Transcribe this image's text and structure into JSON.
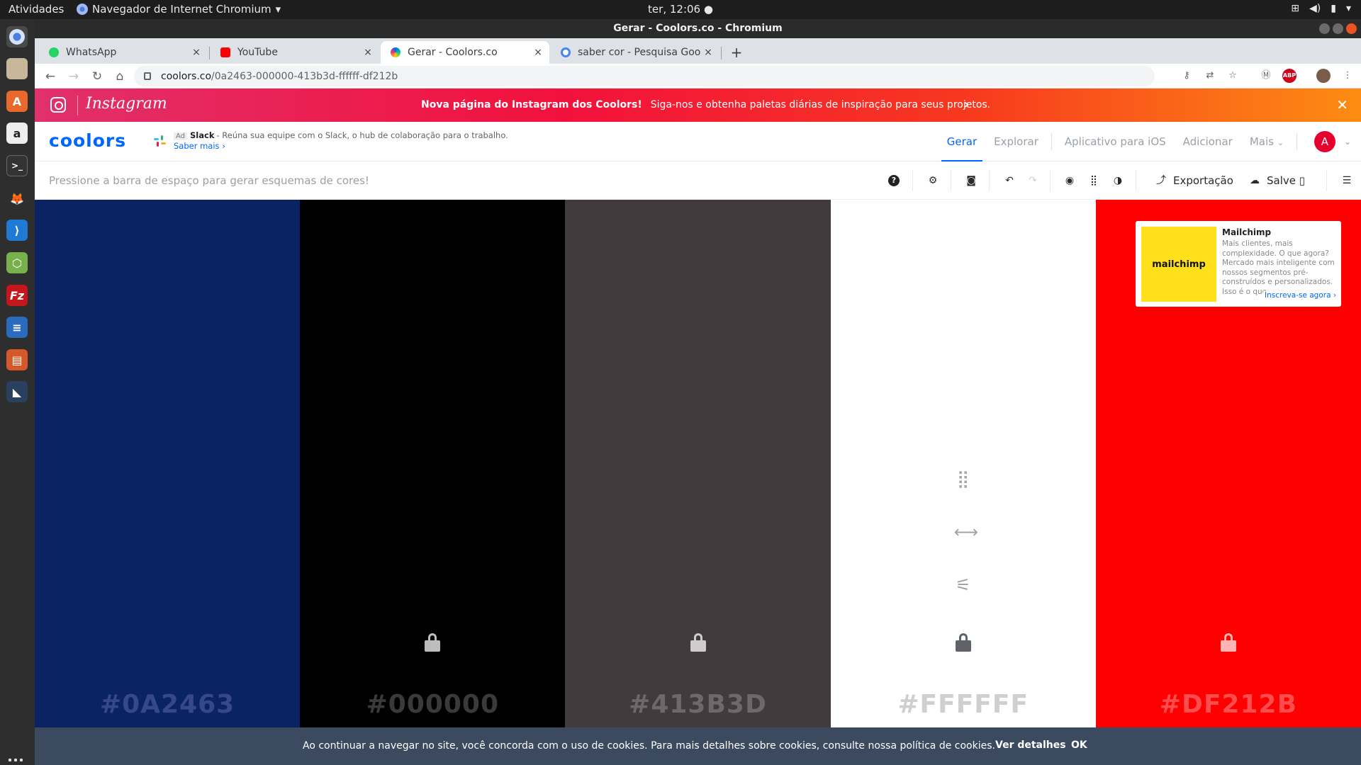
{
  "system": {
    "activities": "Atividades",
    "app_menu": "Navegador de Internet Chromium",
    "clock": "ter, 12:06 ●"
  },
  "window": {
    "title": "Gerar - Coolors.co - Chromium"
  },
  "tabs": [
    {
      "label": "WhatsApp",
      "favicon_color": "#25d366",
      "close": "×"
    },
    {
      "label": "YouTube",
      "favicon_color": "#ff0000",
      "close": "×"
    },
    {
      "label": "Gerar - Coolors.co",
      "favicon_color": "#0066ff",
      "close": "×",
      "active": true
    },
    {
      "label": "saber cor - Pesquisa Goog",
      "favicon_color": "#4285f4",
      "close": "×"
    }
  ],
  "address": {
    "host": "coolors.co",
    "path": "/0a2463-000000-413b3d-ffffff-df212b"
  },
  "ig_banner": {
    "brand": "Instagram",
    "headline": "Nova página do Instagram dos Coolors!",
    "message": "Siga-nos e obtenha paletas diárias de inspiração para seus projetos.",
    "arrow": "›",
    "close": "✕"
  },
  "coolors_nav": {
    "logo": "coolors",
    "ad": {
      "tag": "Ad",
      "brand": "Slack",
      "text": "- Reúna sua equipe com o Slack, o hub de colaboração para o trabalho.",
      "more": "Saber mais ›"
    },
    "links": {
      "generate": "Gerar",
      "explore": "Explorar",
      "ios": "Aplicativo para iOS",
      "add": "Adicionar",
      "more": "Mais"
    },
    "avatar_letter": "A"
  },
  "toolbar": {
    "hint": "Pressione a barra de espaço para gerar esquemas de cores!",
    "export": "Exportação",
    "save": "Salve ▯"
  },
  "palette": [
    {
      "hex": "#0A2463",
      "color": "#0a2463",
      "label_color": "#36478a",
      "lock_color": "#36478a",
      "show_lock": false
    },
    {
      "hex": "#000000",
      "color": "#000000",
      "label_color": "#3a3a3a",
      "lock_color": "#bdbdbd",
      "show_lock": true
    },
    {
      "hex": "#413B3D",
      "color": "#413b3d",
      "label_color": "#6e6869",
      "lock_color": "#d0cccd",
      "show_lock": true
    },
    {
      "hex": "#FFFFFF",
      "color": "#ffffff",
      "label_color": "#cfcfcf",
      "lock_color": "#5f6368",
      "show_lock": true
    },
    {
      "hex": "#DF212B",
      "color": "#ff0000",
      "label_color": "#ff4d4d",
      "lock_color": "#ffb3b3",
      "show_lock": true
    }
  ],
  "ad_card": {
    "image_text": "mailchimp",
    "title": "Mailchimp",
    "body": "Mais clientes, mais complexidade. O que agora? Mercado mais inteligente com nossos segmentos pré-construídos e personalizados. Isso é o que",
    "cta": "Inscreva-se agora ›"
  },
  "cookie": {
    "text": "Ao continuar a navegar no site, você concorda com o uso de cookies. Para mais detalhes sobre cookies, consulte nossa política de cookies.",
    "details": "Ver detalhes",
    "ok": "OK"
  }
}
